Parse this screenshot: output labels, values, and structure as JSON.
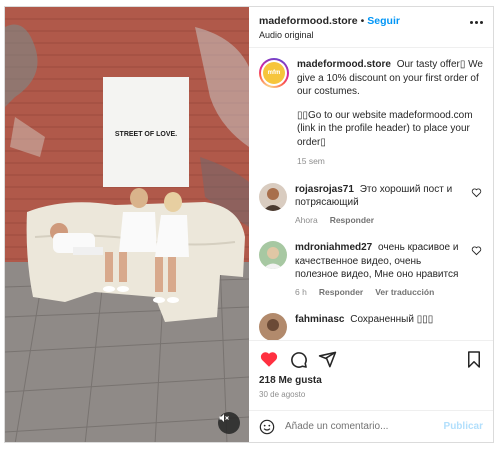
{
  "post": {
    "username": "madeformood.store",
    "separator": "•",
    "follow_label": "Seguir",
    "audio_label": "Audio original"
  },
  "media": {
    "poster_text": "STREET OF LOVE."
  },
  "caption": {
    "avatar_text": "mfm",
    "username": "madeformood.store",
    "line1": "Our tasty offer▯ We give a 10% discount on your first order of our costumes.",
    "line2": "▯▯Go to our website madeformood.com (link in the profile header) to place your order▯",
    "time": "15 sem"
  },
  "comments": [
    {
      "username": "rojasrojas71",
      "text": "Это хороший пост и потрясающий",
      "time": "Ahora",
      "reply_label": "Responder"
    },
    {
      "username": "mdroniahmed27",
      "text": "очень красивое и качественное видео, очень полезное видео, Мне оно нравится",
      "time": "6 h",
      "reply_label": "Responder",
      "translate_label": "Ver traducción"
    },
    {
      "username": "fahminasc",
      "text": "Сохраненный ▯▯▯"
    }
  ],
  "actions": {
    "likes": "218 Me gusta",
    "date": "30 de agosto"
  },
  "composer": {
    "placeholder": "Añade un comentario...",
    "publish_label": "Publicar"
  },
  "colors": {
    "like_red": "#ff3040",
    "link_blue": "#0095f6",
    "publish_disabled": "#b2dffc"
  },
  "icons": [
    "more-icon",
    "heart-icon",
    "comment-icon",
    "share-icon",
    "bookmark-icon",
    "emoji-icon",
    "sound-off-icon"
  ]
}
